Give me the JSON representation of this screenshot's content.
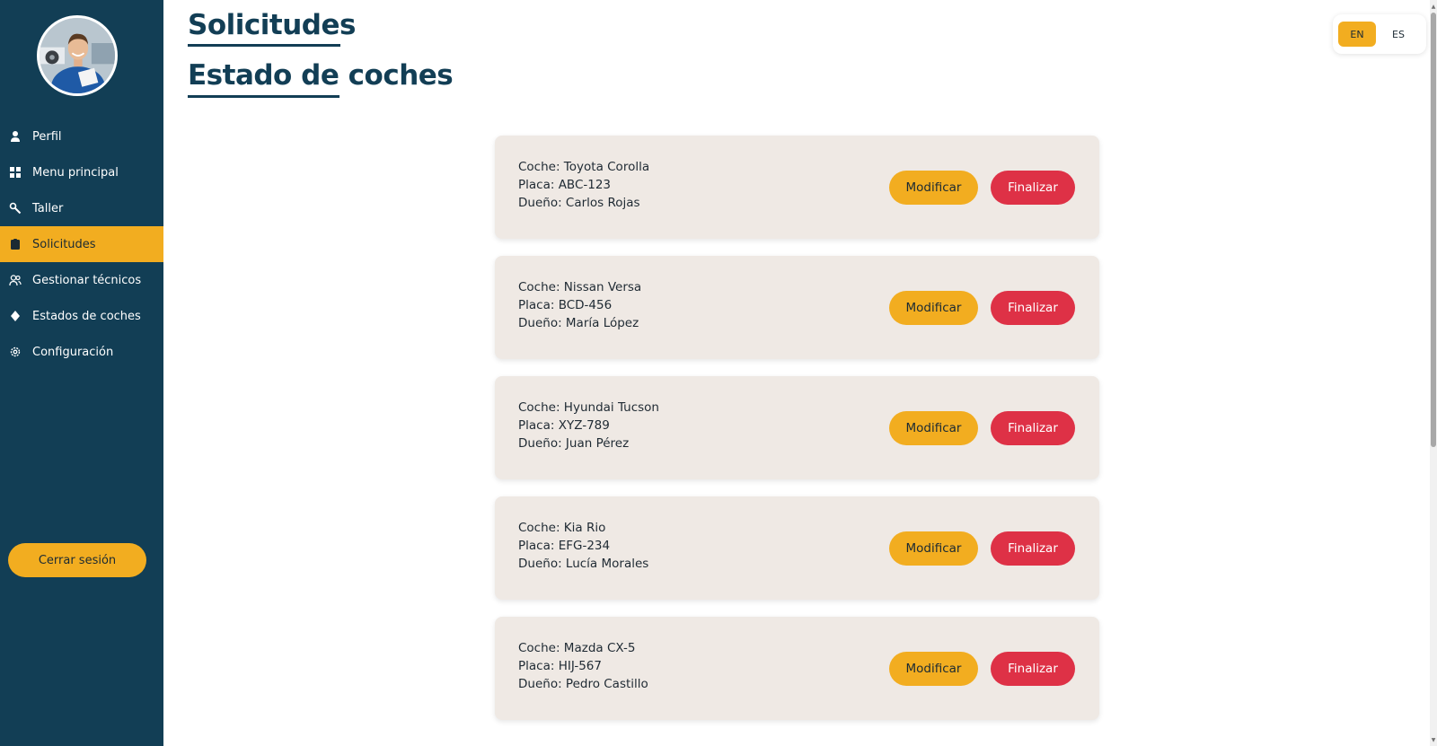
{
  "sidebar": {
    "items": [
      {
        "label": "Perfil",
        "icon": "user-icon"
      },
      {
        "label": "Menu principal",
        "icon": "grid-icon"
      },
      {
        "label": "Taller",
        "icon": "wrench-icon"
      },
      {
        "label": "Solicitudes",
        "icon": "clipboard-icon",
        "active": true
      },
      {
        "label": "Gestionar técnicos",
        "icon": "users-icon"
      },
      {
        "label": "Estados de coches",
        "icon": "diamond-icon"
      },
      {
        "label": "Configuración",
        "icon": "gear-icon"
      }
    ],
    "logout_label": "Cerrar sesión"
  },
  "header": {
    "title": "Solicitudes",
    "subtitle": "Estado de coches"
  },
  "language": {
    "options": [
      "EN",
      "ES"
    ],
    "selected": "EN"
  },
  "cards": [
    {
      "car": "Coche: Toyota Corolla",
      "plate": "Placa: ABC-123",
      "owner": "Dueño: Carlos Rojas"
    },
    {
      "car": "Coche: Nissan Versa",
      "plate": "Placa: BCD-456",
      "owner": "Dueño: María López"
    },
    {
      "car": "Coche: Hyundai Tucson",
      "plate": "Placa: XYZ-789",
      "owner": "Dueño: Juan Pérez"
    },
    {
      "car": "Coche: Kia Rio",
      "plate": "Placa: EFG-234",
      "owner": "Dueño: Lucía Morales"
    },
    {
      "car": "Coche: Mazda CX-5",
      "plate": "Placa: HIJ-567",
      "owner": "Dueño: Pedro Castillo"
    }
  ],
  "actions": {
    "modify_label": "Modificar",
    "finish_label": "Finalizar"
  },
  "colors": {
    "sidebar": "#123e55",
    "accent": "#f2ad20",
    "danger": "#de3146",
    "card": "#efe9e4"
  }
}
